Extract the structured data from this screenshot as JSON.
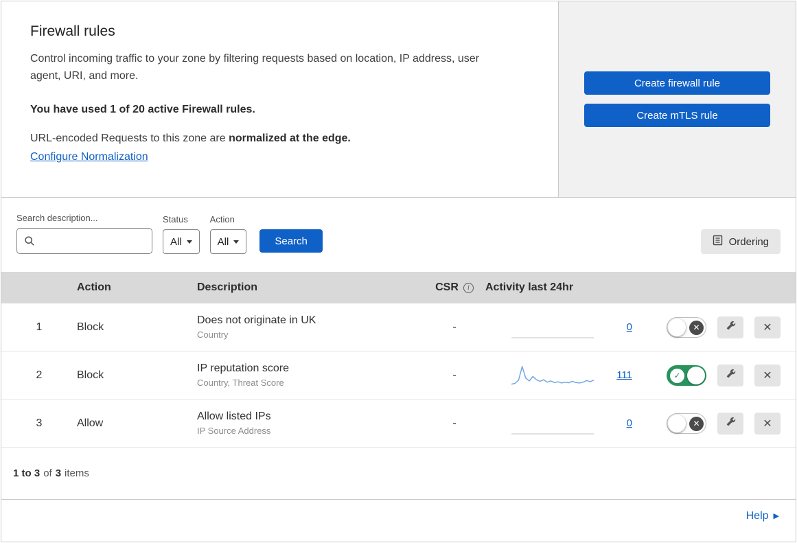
{
  "colors": {
    "primary_blue": "#1061C7",
    "toggle_on_green": "#28935C",
    "sparkline_blue": "#74a9e2",
    "sparkline_flat_gray": "#d8d8d8"
  },
  "header": {
    "title": "Firewall rules",
    "description": "Control incoming traffic to your zone by filtering requests based on location, IP address, user agent, URI, and more.",
    "usage_note": "You have used 1 of 20 active Firewall rules.",
    "normalization_text": "URL-encoded Requests to this zone are",
    "normalization_bold": "normalized at the edge.",
    "normalization_link": "Configure Normalization",
    "create_firewall_button": "Create firewall rule",
    "create_mtls_button": "Create mTLS rule"
  },
  "filters": {
    "search_label": "Search description...",
    "status_label": "Status",
    "status_value": "All",
    "action_label": "Action",
    "action_value": "All",
    "search_button": "Search",
    "ordering_button": "Ordering"
  },
  "table": {
    "columns": {
      "action": "Action",
      "description": "Description",
      "csr": "CSR",
      "activity": "Activity last 24hr"
    },
    "rows": [
      {
        "index": "1",
        "action": "Block",
        "description": "Does not originate in UK",
        "criteria": "Country",
        "csr": "-",
        "activity_count": "0",
        "enabled": false,
        "sparkline": [
          0,
          0,
          0,
          0,
          0,
          0,
          0,
          0,
          0,
          0,
          0,
          0
        ]
      },
      {
        "index": "2",
        "action": "Block",
        "description": "IP reputation score",
        "criteria": "Country, Threat Score",
        "csr": "-",
        "activity_count": "111",
        "enabled": true,
        "sparkline": [
          8,
          12,
          28,
          95,
          38,
          24,
          46,
          30,
          22,
          30,
          18,
          24,
          16,
          20,
          14,
          18,
          15,
          22,
          16,
          14,
          18,
          26,
          20,
          28
        ]
      },
      {
        "index": "3",
        "action": "Allow",
        "description": "Allow listed IPs",
        "criteria": "IP Source Address",
        "csr": "-",
        "activity_count": "0",
        "enabled": false,
        "sparkline": [
          0,
          0,
          0,
          0,
          0,
          0,
          0,
          0,
          0,
          0,
          0,
          0
        ]
      }
    ]
  },
  "footer": {
    "range": "1 to 3",
    "of_text": "of",
    "total": "3",
    "items_text": "items"
  },
  "help": {
    "label": "Help",
    "arrow_icon": "▶"
  }
}
